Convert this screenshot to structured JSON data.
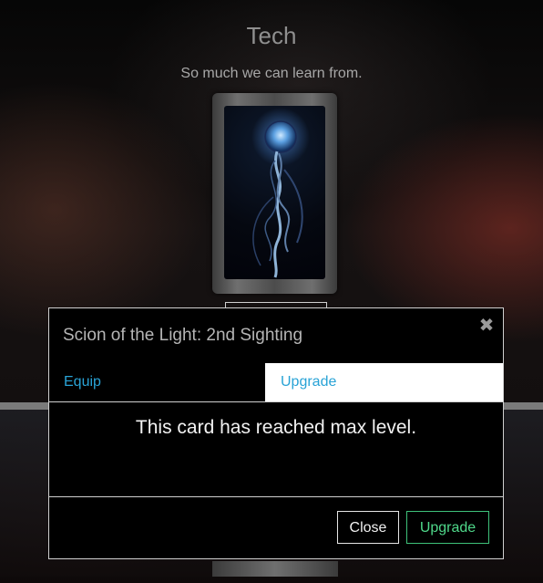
{
  "page": {
    "title": "Tech",
    "subtitle": "So much we can learn from."
  },
  "card": {
    "art_description_icon": "glowing-orb-staff-icon"
  },
  "modal": {
    "title": "Scion of the Light: 2nd Sighting",
    "close_icon": "close-icon",
    "tabs": [
      {
        "label": "Equip",
        "active": false
      },
      {
        "label": "Upgrade",
        "active": true
      }
    ],
    "message": "This card has reached max level.",
    "buttons": {
      "close_label": "Close",
      "upgrade_label": "Upgrade"
    }
  },
  "colors": {
    "tab_text": "#29a3d6",
    "upgrade_button": "#3ec27a",
    "modal_bg": "#000000",
    "modal_border": "#d0d0d0"
  }
}
